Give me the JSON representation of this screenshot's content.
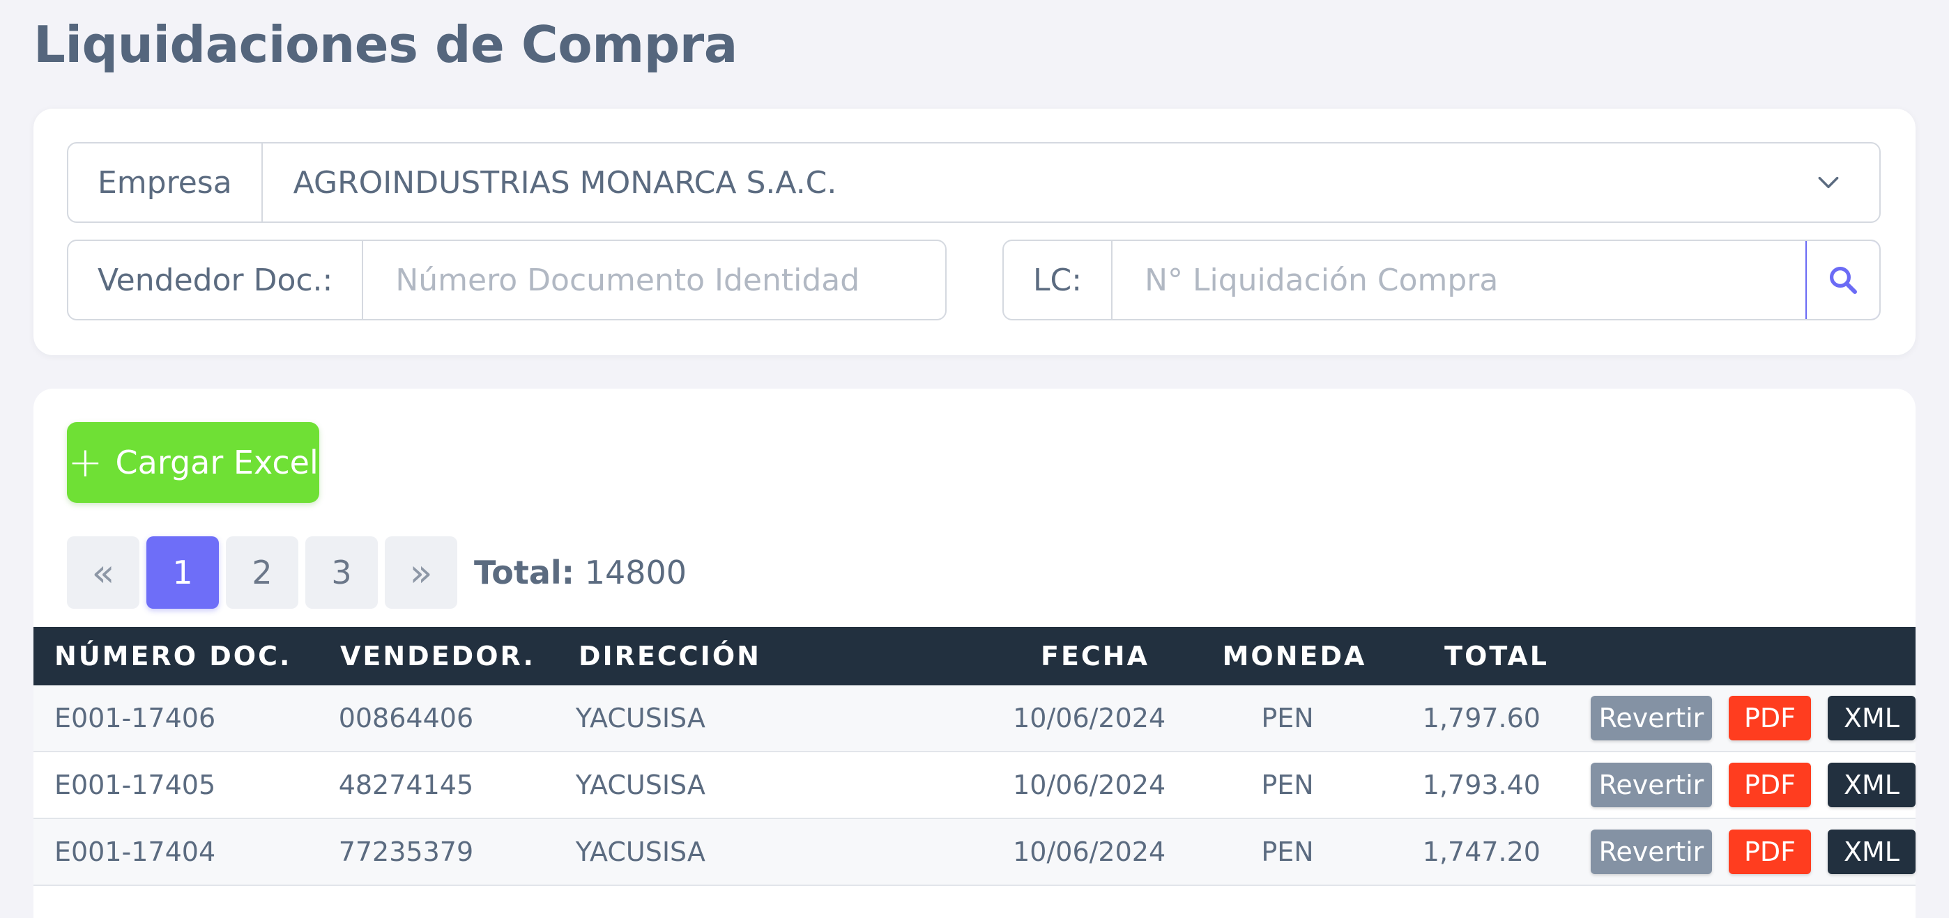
{
  "page": {
    "title": "Liquidaciones de Compra"
  },
  "filters": {
    "empresa_label": "Empresa",
    "empresa_value": "AGROINDUSTRIAS MONARCA S.A.C.",
    "vendedor_label": "Vendedor Doc.:",
    "vendedor_placeholder": "Número Documento Identidad",
    "lc_label": "LC:",
    "lc_placeholder": "N° Liquidación Compra"
  },
  "actions": {
    "cargar_excel": "Cargar Excel",
    "plus": "+"
  },
  "pagination": {
    "first": "«",
    "pages": [
      "1",
      "2",
      "3"
    ],
    "active_page": "1",
    "last": "»",
    "total_label": "Total:",
    "total_value": "14800"
  },
  "table": {
    "headers": [
      "NÚMERO DOC.",
      "VENDEDOR.",
      "DIRECCIÓN",
      "FECHA",
      "MONEDA",
      "TOTAL"
    ],
    "rows": [
      {
        "numero": "E001-17406",
        "vendedor": "00864406",
        "direccion": "YACUSISA",
        "fecha": "10/06/2024",
        "moneda": "PEN",
        "total": "1,797.60"
      },
      {
        "numero": "E001-17405",
        "vendedor": "48274145",
        "direccion": "YACUSISA",
        "fecha": "10/06/2024",
        "moneda": "PEN",
        "total": "1,793.40"
      },
      {
        "numero": "E001-17404",
        "vendedor": "77235379",
        "direccion": "YACUSISA",
        "fecha": "10/06/2024",
        "moneda": "PEN",
        "total": "1,747.20"
      }
    ],
    "row_actions": {
      "revertir": "Revertir",
      "pdf": "PDF",
      "xml": "XML"
    }
  },
  "colors": {
    "accent": "#6e6ef8",
    "success": "#6fe035",
    "danger": "#ff3d1f",
    "dark": "#22303f",
    "muted": "#8492a4"
  },
  "icons": {
    "chevron": "chevron-down-icon",
    "search": "search-icon"
  }
}
